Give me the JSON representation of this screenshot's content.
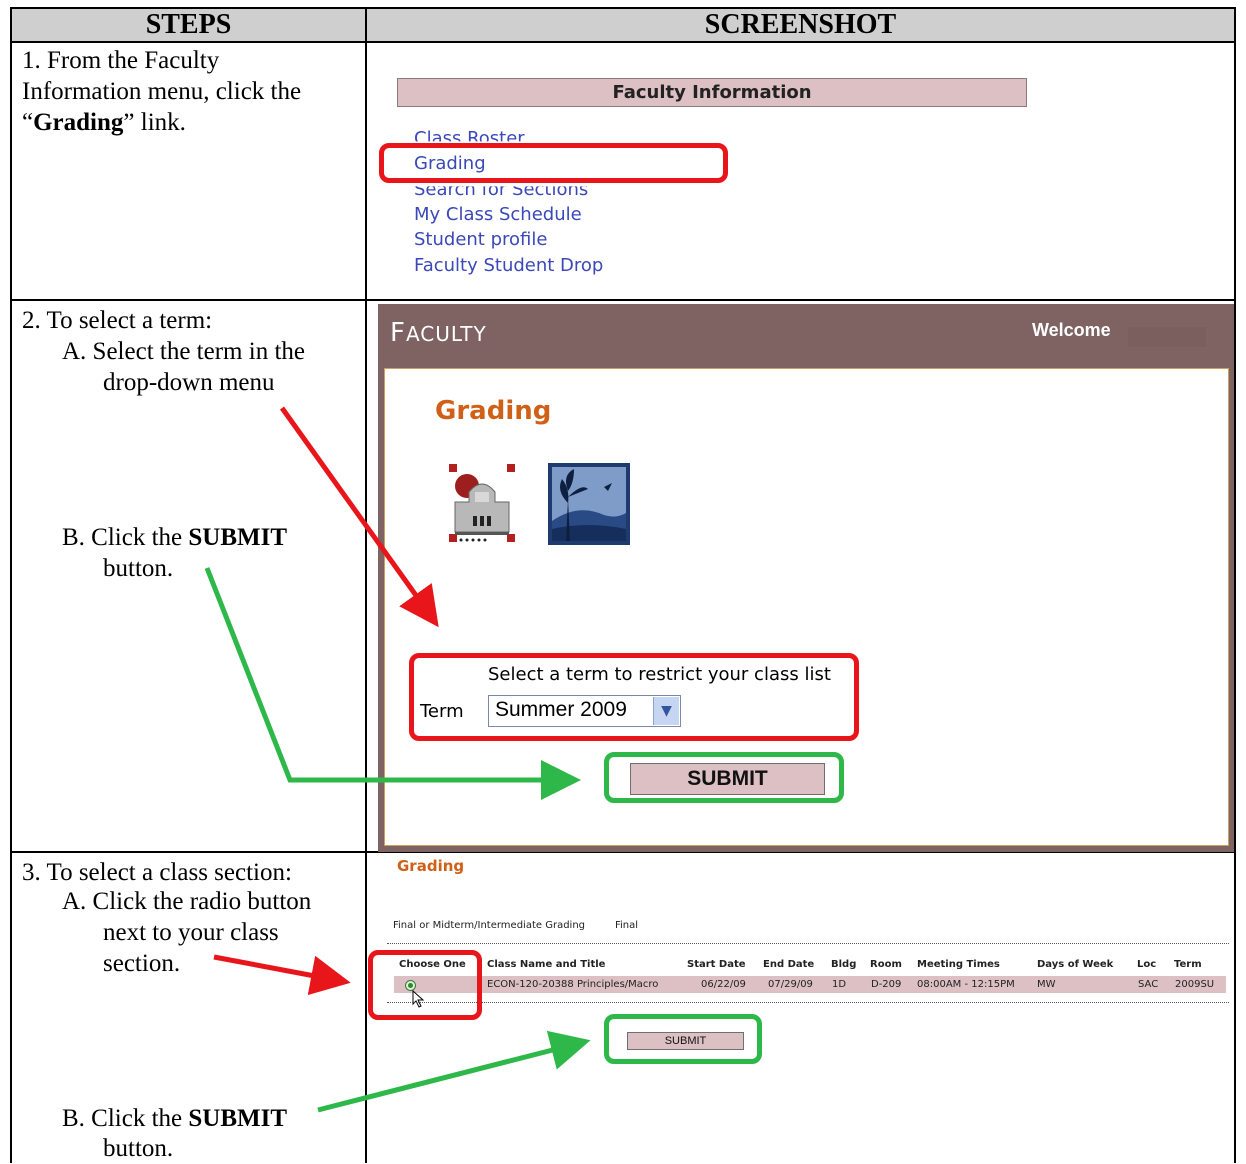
{
  "header": {
    "steps": "STEPS",
    "screenshot": "SCREENSHOT"
  },
  "step1": {
    "line1": "1.  From the Faculty",
    "line2": "Information menu, click the",
    "quote_open": "“",
    "bold": "Grading",
    "quote_close": "” link."
  },
  "faculty_info": {
    "title": "Faculty Information",
    "links": [
      "Class Roster",
      "Grading",
      "Search for Sections",
      "My Class Schedule",
      "Student profile",
      "Faculty Student Drop"
    ]
  },
  "step2": {
    "line1": "2.  To select a term:",
    "a1": "A.  Select the term in the",
    "a2": "drop-down menu",
    "b_prefix": "B.  Click the ",
    "b_bold": "SUBMIT",
    "b2": "button."
  },
  "faculty_panel": {
    "title_first": "F",
    "title_rest": "ACULTY",
    "welcome": "Welcome",
    "heading": "Grading",
    "term_note": "Select a term to restrict your class list",
    "term_label": "Term",
    "term_value": "Summer 2009",
    "submit": "SUBMIT"
  },
  "step3": {
    "line1": "3.  To select a class section:",
    "a1": "A.  Click the radio button",
    "a2": "next to your class",
    "a3": "section.",
    "b_prefix": "B.  Click the ",
    "b_bold": "SUBMIT",
    "b2": "button."
  },
  "grading_list": {
    "title": "Grading",
    "grading_type_label": "Final or Midterm/Intermediate Grading",
    "grading_type_value": "Final",
    "columns": [
      "Choose One",
      "Class Name and Title",
      "Start Date",
      "End Date",
      "Bldg",
      "Room",
      "Meeting Times",
      "Days of Week",
      "Loc",
      "Term"
    ],
    "row": [
      "ECON-120-20388 Principles/Macro",
      "06/22/09",
      "07/29/09",
      "1D",
      "D-209",
      "08:00AM - 12:15PM",
      "MW",
      "SAC",
      "2009SU"
    ],
    "submit": "SUBMIT"
  },
  "colors": {
    "red_highlight": "#e8161b",
    "green_highlight": "#2fb84a",
    "header_bar": "#dcc0c3",
    "frame": "#7e6362",
    "heading_orange": "#d06018",
    "link_blue": "#3a48b8"
  }
}
